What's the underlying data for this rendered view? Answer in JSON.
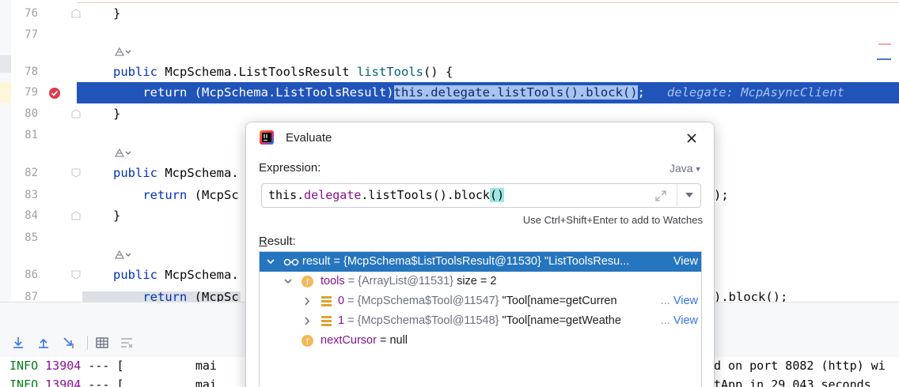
{
  "editor": {
    "lines": [
      {
        "num": "76",
        "code": "}"
      },
      {
        "num": "77",
        "code": ""
      },
      {
        "num": "78",
        "code_kw": "public",
        "code_rest": " McpSchema.ListToolsResult ",
        "code_fn": "listTools",
        "code_end": "() {"
      },
      {
        "num": "79",
        "code_pre": "    return (McpSchema.ListToolsResult)",
        "code_sel": "this.delegate.listTools().block()",
        "code_post": ";",
        "inline_hint": "delegate: McpAsyncClient"
      },
      {
        "num": "80",
        "code": "}"
      },
      {
        "num": "81",
        "code": ""
      },
      {
        "num": "82",
        "code_kw": "public",
        "code_rest": " McpSchema."
      },
      {
        "num": "83",
        "code_kw": "    return",
        "code_rest": " (McpSc",
        "code_tail": ");"
      },
      {
        "num": "84",
        "code": "}"
      },
      {
        "num": "85",
        "code": ""
      },
      {
        "num": "86",
        "code_kw": "public",
        "code_rest": " McpSchema."
      },
      {
        "num": "87",
        "code_kw": "    return",
        "code_rest": " (McpSc",
        "code_tail": ").block();"
      }
    ]
  },
  "console": {
    "lines": [
      {
        "level": "INFO",
        "pid": "13904",
        "sep": "--- [",
        "thread": "mai",
        "tail": "d on port 8082 (http) wi"
      },
      {
        "level": "INFO",
        "pid": "13904",
        "sep": "--- [",
        "thread": "mai",
        "tail": "tApp in 29.043 seconds"
      }
    ]
  },
  "dialog": {
    "title": "Evaluate",
    "expression_label": "Expression:",
    "language": "Java",
    "expression": {
      "pre": "this.",
      "field": "delegate",
      "mid": ".listTools().block",
      "paren": "()"
    },
    "watch_hint": "Use Ctrl+Shift+Enter to add to Watches",
    "result_label_u": "R",
    "result_label_rest": "esult:",
    "result_tree": [
      {
        "name": "result",
        "value": " = {McpSchema$ListToolsResult@11530} \"ListToolsResu",
        "view": "View",
        "selected": true
      },
      {
        "name": "tools",
        "type": " = {ArrayList@11531} ",
        "value": "size = 2"
      },
      {
        "name": "0",
        "type": " = {McpSchema$Tool@11547} ",
        "value": "\"Tool[name=getCurren",
        "view": "View"
      },
      {
        "name": "1",
        "type": " = {McpSchema$Tool@11548} ",
        "value": "\"Tool[name=getWeathe",
        "view": "View"
      },
      {
        "name": "nextCursor",
        "value": " = null"
      }
    ]
  },
  "colors": {
    "exec_line": "#2154b9",
    "selection": "#2675bf",
    "keyword": "#0033b3",
    "field": "#871094",
    "info": "#067d17"
  }
}
